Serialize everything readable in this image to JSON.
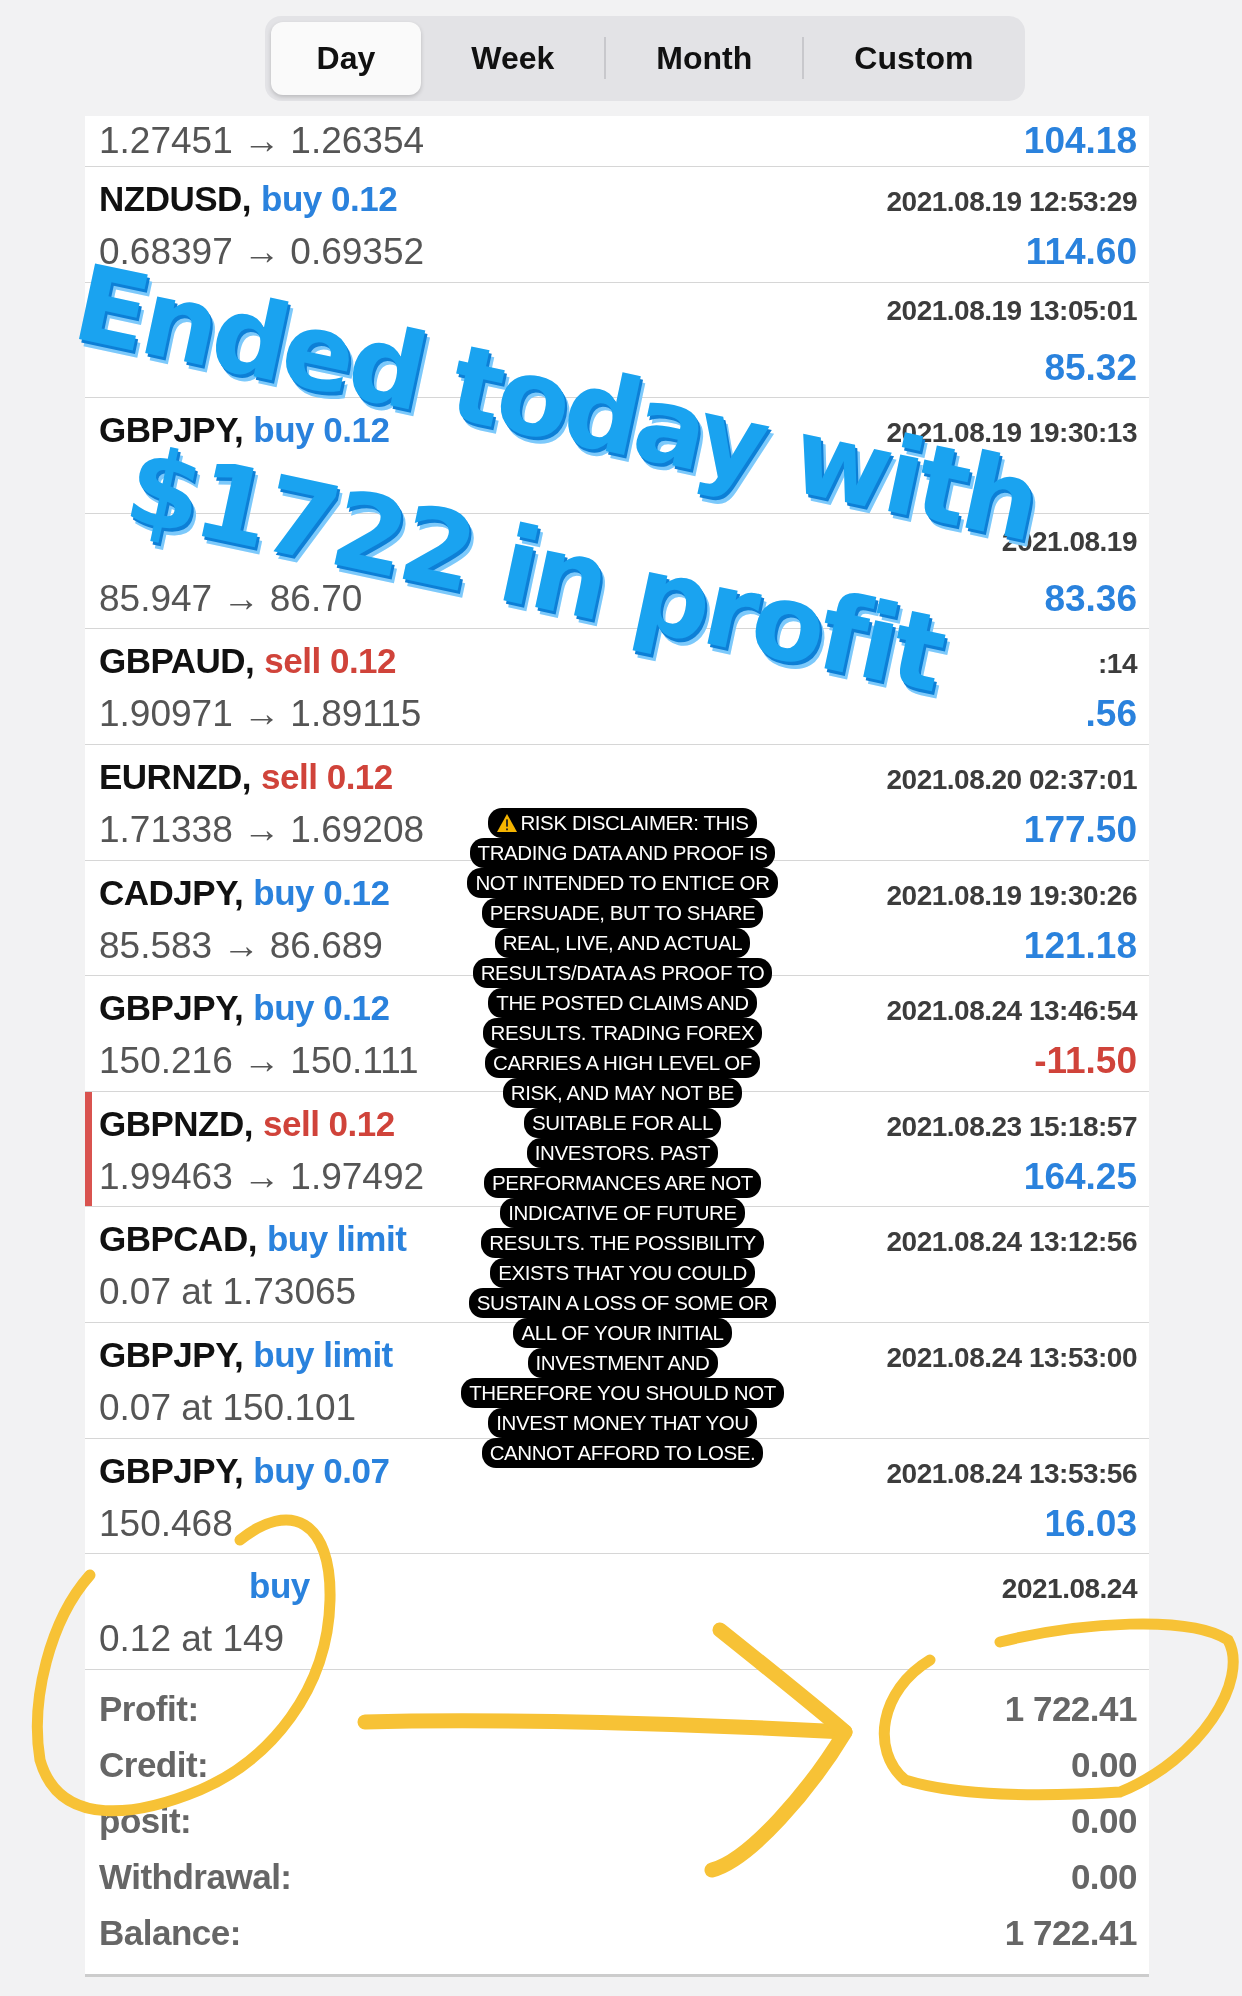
{
  "tabs": [
    {
      "label": "Day",
      "selected": true
    },
    {
      "label": "Week",
      "selected": false
    },
    {
      "label": "Month",
      "selected": false
    },
    {
      "label": "Custom",
      "selected": false
    }
  ],
  "rows": [
    {
      "prices": "1.27451 → 1.26354",
      "profit": "104.18",
      "loss": false,
      "marked": false
    },
    {
      "symbol": "NZDUSD,",
      "order": "buy 0.12",
      "kind": "buy",
      "time": "2021.08.19 12:53:29",
      "prices": "0.68397 → 0.69352",
      "profit": "114.60",
      "loss": false,
      "marked": false
    },
    {
      "time": "2021.08.19 13:05:01",
      "profit": "85.32",
      "loss": false,
      "marked": false
    },
    {
      "symbol": "GBPJPY,",
      "order": "buy 0.12",
      "kind": "buy",
      "time": "2021.08.19 19:30:13",
      "marked": false
    },
    {
      "time": "2021.08.19",
      "prices": "85.947 → 86.70",
      "profit": "83.36",
      "loss": false,
      "marked": false
    },
    {
      "symbol": "GBPAUD,",
      "order": "sell 0.12",
      "kind": "sell",
      "time": ":14",
      "prices": "1.90971 → 1.89115",
      "profit": ".56",
      "loss": false,
      "marked": false
    },
    {
      "symbol": "EURNZD,",
      "order": "sell 0.12",
      "kind": "sell",
      "time": "2021.08.20 02:37:01",
      "prices": "1.71338 → 1.69208",
      "profit": "177.50",
      "loss": false,
      "marked": false
    },
    {
      "symbol": "CADJPY,",
      "order": "buy 0.12",
      "kind": "buy",
      "time": "2021.08.19 19:30:26",
      "prices": "85.583 → 86.689",
      "profit": "121.18",
      "loss": false,
      "marked": false
    },
    {
      "symbol": "GBPJPY,",
      "order": "buy 0.12",
      "kind": "buy",
      "time": "2021.08.24 13:46:54",
      "prices": "150.216 → 150.111",
      "profit": "-11.50",
      "loss": true,
      "marked": false
    },
    {
      "symbol": "GBPNZD,",
      "order": "sell 0.12",
      "kind": "sell",
      "time": "2021.08.23 15:18:57",
      "prices": "1.99463 → 1.97492",
      "profit": "164.25",
      "loss": false,
      "marked": true
    },
    {
      "symbol": "GBPCAD,",
      "order": "buy limit",
      "kind": "buy",
      "time": "2021.08.24 13:12:56",
      "prices": "0.07 at 1.73065",
      "marked": false
    },
    {
      "symbol": "GBPJPY,",
      "order": "buy limit",
      "kind": "buy",
      "time": "2021.08.24 13:53:00",
      "prices": "0.07 at 150.101",
      "marked": false
    },
    {
      "symbol": "GBPJPY,",
      "order": "buy 0.07",
      "kind": "buy",
      "time": "2021.08.24 13:53:56",
      "prices": "150.468",
      "profit": "16.03",
      "loss": false,
      "marked": false
    },
    {
      "order": "buy",
      "kind": "buy",
      "time": "2021.08.24",
      "prices": "0.12 at 149",
      "marked": false
    }
  ],
  "summary": [
    {
      "label": "Profit:",
      "value": "1 722.41"
    },
    {
      "label": "Credit:",
      "value": "0.00"
    },
    {
      "label": "posit:",
      "value": "0.00"
    },
    {
      "label": "Withdrawal:",
      "value": "0.00"
    },
    {
      "label": "Balance:",
      "value": "1 722.41"
    }
  ],
  "sticker": {
    "lines": [
      "Ended today with",
      "$1722 in profit"
    ]
  },
  "disclaimer": {
    "lines": [
      "RISK DISCLAIMER: THIS",
      "TRADING DATA AND PROOF IS",
      "NOT INTENDED TO ENTICE OR",
      "PERSUADE, BUT TO SHARE",
      "REAL, LIVE, AND ACTUAL",
      "RESULTS/DATA AS PROOF TO",
      "THE POSTED CLAIMS AND",
      "RESULTS. TRADING FOREX",
      "CARRIES A HIGH LEVEL OF",
      "RISK, AND MAY NOT BE",
      "SUITABLE FOR ALL",
      "INVESTORS. PAST",
      "PERFORMANCES ARE NOT",
      "INDICATIVE OF FUTURE",
      "RESULTS. THE POSSIBILITY",
      "EXISTS THAT YOU COULD",
      "SUSTAIN A LOSS OF SOME OR",
      "ALL OF YOUR INITIAL",
      "INVESTMENT AND",
      "THEREFORE YOU SHOULD NOT",
      "INVEST MONEY THAT YOU",
      "CANNOT AFFORD TO LOSE."
    ]
  }
}
